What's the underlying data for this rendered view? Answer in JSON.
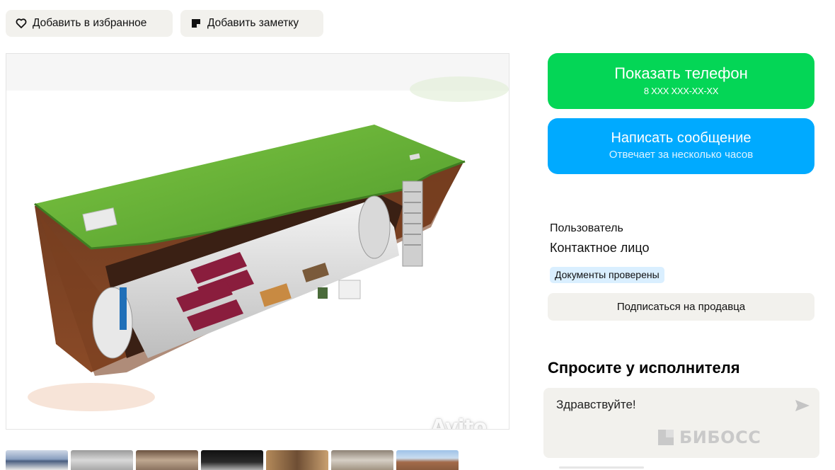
{
  "actions": {
    "favorite_label": "Добавить в избранное",
    "note_label": "Добавить заметку"
  },
  "gallery": {
    "watermark": "Avito",
    "thumbnail_count": 7
  },
  "contact": {
    "show_phone_label": "Показать телефон",
    "phone_masked": "8 XXX XXX-XX-XX",
    "message_label": "Написать сообщение",
    "message_sub": "Отвечает за несколько часов"
  },
  "seller": {
    "name": "Пользователь",
    "role": "Контактное лицо",
    "badge": "Документы проверены",
    "subscribe_label": "Подписаться на продавца"
  },
  "ask": {
    "title": "Спросите у исполнителя",
    "message_value": "Здравствуйте!",
    "watermark": "БИБОСС"
  },
  "colors": {
    "green": "#04d656",
    "blue": "#00aaff",
    "chip_bg": "#f2f1ed",
    "badge_bg": "#daefff"
  }
}
